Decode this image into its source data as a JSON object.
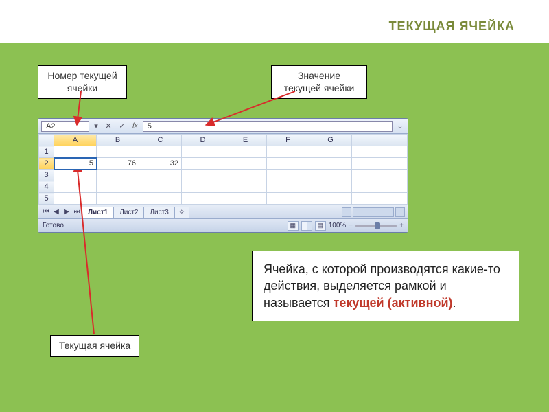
{
  "title": "ТЕКУЩАЯ ЯЧЕЙКА",
  "callouts": {
    "number": "Номер текущей ячейки",
    "value": "Значение текущей ячейки",
    "current": "Текущая ячейка"
  },
  "explanation": {
    "text_before": "Ячейка, с которой производятся  какие-то действия, выделяется рамкой и называется ",
    "keyword": "текущей (активной)",
    "period": "."
  },
  "excel": {
    "namebox": "A2",
    "fx_value": "5",
    "columns": [
      "A",
      "B",
      "C",
      "D",
      "E",
      "F",
      "G"
    ],
    "rows": [
      "1",
      "2",
      "3",
      "4",
      "5"
    ],
    "active": {
      "row": 2,
      "col": "A"
    },
    "cells": {
      "A2": "5",
      "B2": "76",
      "C2": "32"
    },
    "sheets": {
      "active": "Лист1",
      "others": [
        "Лист2",
        "Лист3"
      ]
    },
    "status": "Готово",
    "zoom": "100%",
    "zoom_plus": "+",
    "zoom_minus": "−",
    "fx_label": "fx",
    "dd_glyph": "▾",
    "expand_glyph": "⌄",
    "nav": {
      "first": "⏮",
      "prev": "◀",
      "next": "▶",
      "last": "⏭"
    }
  }
}
